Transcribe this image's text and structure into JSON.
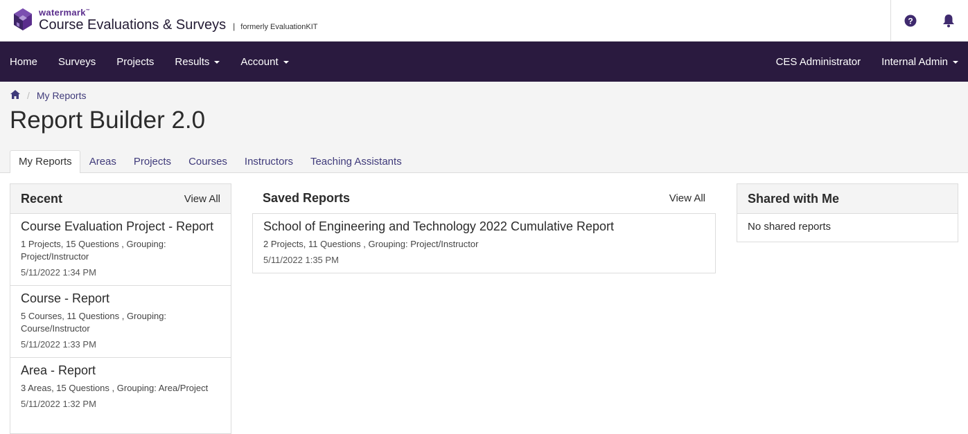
{
  "brand": {
    "small": "watermark",
    "tm": "™",
    "title": "Course Evaluations & Surveys",
    "separator": "|",
    "formerly": "formerly EvaluationKIT"
  },
  "topbar_icons": [
    "help-icon",
    "bell-icon"
  ],
  "nav": {
    "left": [
      {
        "label": "Home",
        "dropdown": false
      },
      {
        "label": "Surveys",
        "dropdown": false
      },
      {
        "label": "Projects",
        "dropdown": false
      },
      {
        "label": "Results",
        "dropdown": true
      },
      {
        "label": "Account",
        "dropdown": true
      }
    ],
    "right": [
      {
        "label": "CES Administrator",
        "dropdown": false
      },
      {
        "label": "Internal Admin",
        "dropdown": true
      }
    ]
  },
  "breadcrumb": {
    "separator": "/",
    "current": "My Reports"
  },
  "page_title": "Report Builder 2.0",
  "tabs": [
    {
      "label": "My Reports",
      "active": true
    },
    {
      "label": "Areas",
      "active": false
    },
    {
      "label": "Projects",
      "active": false
    },
    {
      "label": "Courses",
      "active": false
    },
    {
      "label": "Instructors",
      "active": false
    },
    {
      "label": "Teaching Assistants",
      "active": false
    }
  ],
  "recent": {
    "title": "Recent",
    "view_all": "View All",
    "items": [
      {
        "title": "Course Evaluation Project - Report",
        "desc": "1 Projects, 15 Questions , Grouping: Project/Instructor",
        "date": "5/11/2022 1:34 PM"
      },
      {
        "title": "Course - Report",
        "desc": "5 Courses, 11 Questions , Grouping: Course/Instructor",
        "date": "5/11/2022 1:33 PM"
      },
      {
        "title": "Area - Report",
        "desc": "3 Areas, 15 Questions , Grouping: Area/Project",
        "date": "5/11/2022 1:32 PM"
      }
    ]
  },
  "saved": {
    "title": "Saved Reports",
    "view_all": "View All",
    "items": [
      {
        "title": "School of Engineering and Technology 2022 Cumulative Report",
        "desc": "2 Projects, 11 Questions , Grouping: Project/Instructor",
        "date": "5/11/2022 1:35 PM"
      }
    ]
  },
  "shared": {
    "title": "Shared with Me",
    "empty": "No shared reports"
  },
  "colors": {
    "nav_bg": "#2a1a3f",
    "brand_purple": "#5a2d8c",
    "link": "#3f3a7a",
    "band_bg": "#f4f4f4"
  }
}
